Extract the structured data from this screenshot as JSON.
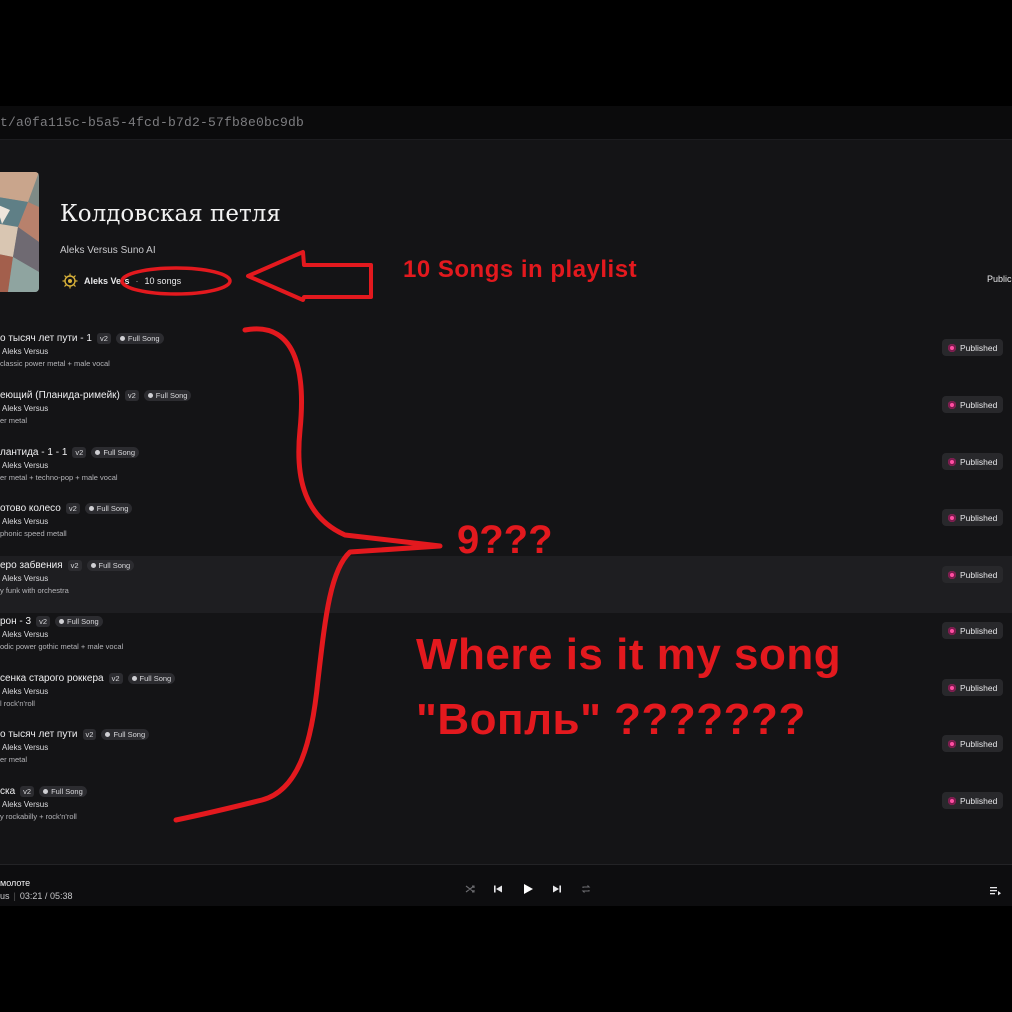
{
  "browser": {
    "url": "t/a0fa115c-b5a5-4fcd-b7d2-57fb8e0bc9db"
  },
  "playlist": {
    "title": "Колдовская петля",
    "description": "Aleks Versus Suno AI",
    "owner": "Aleks Ve",
    "owner_tail": "rs",
    "separator": "·",
    "song_count": "10 songs",
    "visibility": "Public"
  },
  "tracks": [
    {
      "title": "о тысяч лет пути - 1",
      "version": "v2",
      "type": "Full Song",
      "artist": "Aleks Versus",
      "style": "classic power metal + male vocal",
      "status": "Published"
    },
    {
      "title": "еющий (Планида-римейк)",
      "version": "v2",
      "type": "Full Song",
      "artist": "Aleks Versus",
      "style": "er metal",
      "status": "Published"
    },
    {
      "title": "лантида - 1 - 1",
      "version": "v2",
      "type": "Full Song",
      "artist": "Aleks Versus",
      "style": "er metal + techno-pop + male vocal",
      "status": "Published"
    },
    {
      "title": "отово колесо",
      "version": "v2",
      "type": "Full Song",
      "artist": "Aleks Versus",
      "style": "phonic speed metall",
      "status": "Published"
    },
    {
      "title": "еро забвения",
      "version": "v2",
      "type": "Full Song",
      "artist": "Aleks Versus",
      "style": "y funk with orchestra",
      "status": "Published"
    },
    {
      "title": "рон - 3",
      "version": "v2",
      "type": "Full Song",
      "artist": "Aleks Versus",
      "style": "odic power gothic metal + male vocal",
      "status": "Published"
    },
    {
      "title": "сенка старого роккера",
      "version": "v2",
      "type": "Full Song",
      "artist": "Aleks Versus",
      "style": "l rock'n'roll",
      "status": "Published"
    },
    {
      "title": "о тысяч лет пути",
      "version": "v2",
      "type": "Full Song",
      "artist": "Aleks Versus",
      "style": "er metal",
      "status": "Published"
    },
    {
      "title": "ска",
      "version": "v2",
      "type": "Full Song",
      "artist": "Aleks Versus",
      "style": "y rockabilly + rock'n'roll",
      "status": "Published"
    }
  ],
  "player": {
    "title": "молоте",
    "artist": "us",
    "elapsed": "03:21",
    "time_separator": "/",
    "duration": "05:38"
  },
  "annotations": {
    "arrow_text": "10 Songs in playlist",
    "count_text": "9???",
    "question_line1": "Where is it my song",
    "question_line2": "\"Вопль\" ???????"
  },
  "colors": {
    "annotation_red": "#e3191e",
    "published_dot": "#ff4fa3",
    "background": "#141416"
  },
  "icons": [
    "owner-logo-icon",
    "shuffle-icon",
    "previous-icon",
    "play-icon",
    "next-icon",
    "repeat-icon",
    "queue-icon"
  ]
}
